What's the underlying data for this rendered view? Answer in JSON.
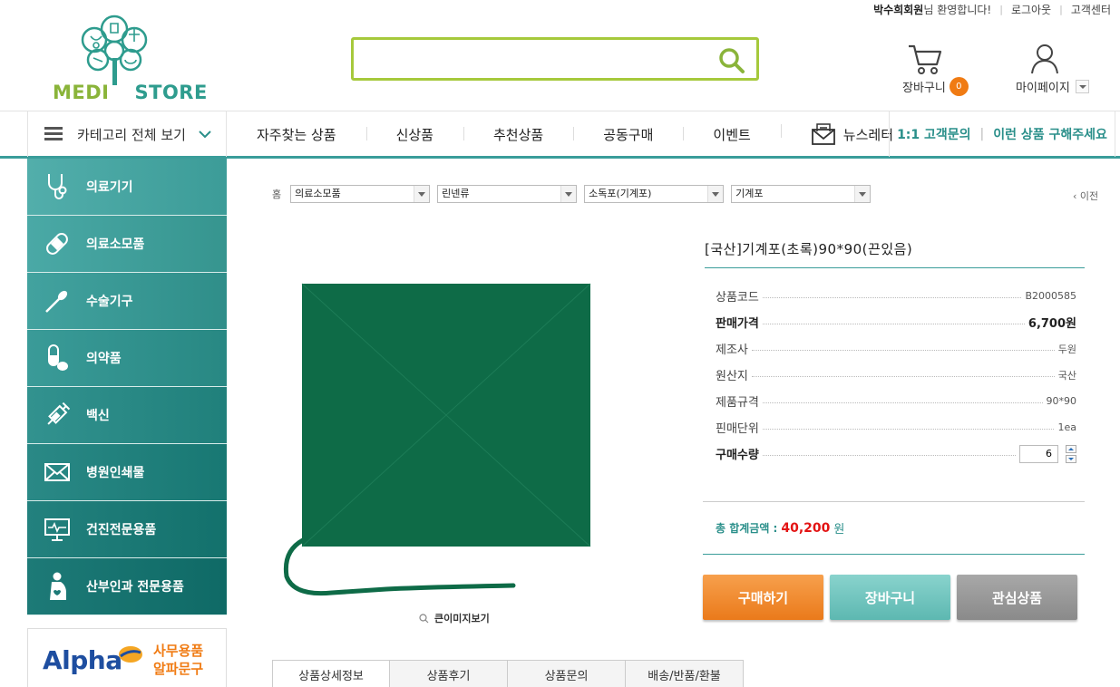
{
  "util": {
    "user_name": "박수희회원",
    "welcome": "님 환영합니다!",
    "logout": "로그아웃",
    "customer_center": "고객센터"
  },
  "logo": {
    "part1": "MEDI",
    "part2": "STORE"
  },
  "search": {
    "value": "",
    "placeholder": ""
  },
  "cart": {
    "label": "장바구니",
    "count": "0"
  },
  "mypage": {
    "label": "마이페이지"
  },
  "nav": {
    "all_categories": "카테고리 전체 보기",
    "items": [
      "자주찾는 상품",
      "신상품",
      "추천상품",
      "공동구매",
      "이벤트",
      "뉴스레터"
    ],
    "right": [
      "1:1 고객문의",
      "이런 상품 구해주세요"
    ]
  },
  "sidebar": {
    "colors": [
      "#4aa9a6",
      "#2e8f8b",
      "#166a67"
    ],
    "items": [
      {
        "label": "의료기기",
        "icon": "stethoscope-icon"
      },
      {
        "label": "의료소모품",
        "icon": "bandage-icon"
      },
      {
        "label": "수술기구",
        "icon": "scalpel-icon"
      },
      {
        "label": "의약품",
        "icon": "capsule-icon"
      },
      {
        "label": "백신",
        "icon": "syringe-icon"
      },
      {
        "label": "병원인쇄물",
        "icon": "envelope-icon"
      },
      {
        "label": "건진전문용품",
        "icon": "monitor-icon"
      },
      {
        "label": "산부인과 전문용품",
        "icon": "pregnant-icon"
      }
    ]
  },
  "banner": {
    "brand": "Alpha",
    "line1": "사무용품",
    "line2": "알파문구"
  },
  "breadcrumb": {
    "home": "홈",
    "selects": [
      "의료소모품",
      "린넨류",
      "소독포(기계포)",
      "기계포"
    ],
    "prev": "이전"
  },
  "product": {
    "title": "[국산]기계포(초록)90*90(끈있음)",
    "image_color": "#0e6b47",
    "zoom_label": "큰이미지보기",
    "specs": [
      {
        "key": "상품코드",
        "value": "B2000585",
        "bold": false
      },
      {
        "key": "판매가격",
        "value": "6,700원",
        "bold": true
      },
      {
        "key": "제조사",
        "value": "두원",
        "bold": false
      },
      {
        "key": "원산지",
        "value": "국산",
        "bold": false
      },
      {
        "key": "제품규격",
        "value": "90*90",
        "bold": false
      },
      {
        "key": "핀매단위",
        "value": "1ea",
        "bold": false
      }
    ],
    "qty_label": "구매수량",
    "qty_value": "6",
    "total_label": "총 합계금액 :",
    "total_amount": "40,200",
    "total_unit": "원"
  },
  "buttons": {
    "buy": "구매하기",
    "cart": "장바구니",
    "wish": "관심상품"
  },
  "tabs": [
    "상품상세정보",
    "상품후기",
    "상품문의",
    "배송/반품/환불"
  ]
}
